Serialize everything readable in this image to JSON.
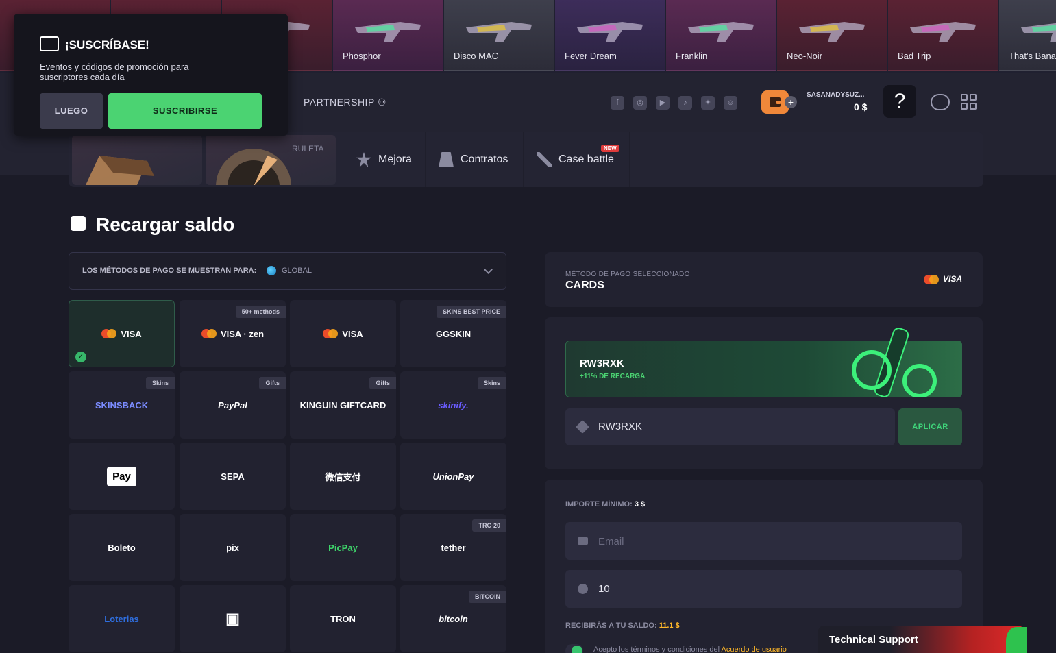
{
  "feed": [
    {
      "name": "",
      "rarity": "r-red"
    },
    {
      "name": "",
      "rarity": "r-red"
    },
    {
      "name": "",
      "rarity": "r-red"
    },
    {
      "name": "Phosphor",
      "rarity": "r-pink"
    },
    {
      "name": "Disco MAC",
      "rarity": "r-gray"
    },
    {
      "name": "Fever Dream",
      "rarity": "r-purple"
    },
    {
      "name": "Franklin",
      "rarity": "r-pink"
    },
    {
      "name": "Neo-Noir",
      "rarity": "r-red"
    },
    {
      "name": "Bad Trip",
      "rarity": "r-red"
    },
    {
      "name": "That's Bananas",
      "rarity": "r-gray"
    }
  ],
  "popup": {
    "title": "¡SUSCRÍBASE!",
    "text": "Eventos y códigos de promoción para suscriptores cada día",
    "later": "LUEGO",
    "subscribe": "SUSCRIBIRSE"
  },
  "header": {
    "partnership": "PARTNERSHIP",
    "username": "SASANADYSUZ...",
    "balance": "0 $",
    "help": "?",
    "socials": [
      "facebook-icon",
      "instagram-icon",
      "youtube-icon",
      "tiktok-icon",
      "twitter-icon",
      "discord-icon"
    ]
  },
  "nav": {
    "ruleta": "RULETA",
    "upgrade": "Mejora",
    "contracts": "Contratos",
    "battle": "Case battle",
    "new_badge": "NEW"
  },
  "page": {
    "title": "Recargar saldo",
    "region_label": "LOS MÉTODOS DE PAGO SE MUESTRAN PARA:",
    "region_value": "GLOBAL"
  },
  "methods": [
    {
      "label": "VISA",
      "tag": "",
      "selected": true
    },
    {
      "label": "VISA · zen",
      "tag": "50+ methods"
    },
    {
      "label": "VISA",
      "tag": ""
    },
    {
      "label": "GGSKIN",
      "tag": "SKINS BEST PRICE"
    },
    {
      "label": "SKINSBACK",
      "tag": "Skins"
    },
    {
      "label": "PayPal",
      "tag": "Gifts"
    },
    {
      "label": "KINGUIN GIFTCARD",
      "tag": "Gifts"
    },
    {
      "label": "skinify.",
      "tag": "Skins"
    },
    {
      "label": "Pay",
      "tag": ""
    },
    {
      "label": "SEPA",
      "tag": ""
    },
    {
      "label": "微信支付",
      "tag": ""
    },
    {
      "label": "UnionPay",
      "tag": ""
    },
    {
      "label": "Boleto",
      "tag": ""
    },
    {
      "label": "pix",
      "tag": ""
    },
    {
      "label": "PicPay",
      "tag": ""
    },
    {
      "label": "tether",
      "tag": "TRC-20"
    },
    {
      "label": "Loterias",
      "tag": ""
    },
    {
      "label": "",
      "tag": ""
    },
    {
      "label": "TRON",
      "tag": ""
    },
    {
      "label": "bitcoin",
      "tag": "BITCOIN"
    }
  ],
  "selected_method": {
    "small": "MÉTODO DE PAGO SELECCIONADO",
    "name": "CARDS",
    "brand": "VISA"
  },
  "promo": {
    "banner_code": "RW3RXK",
    "banner_sub": "+11% DE RECARGA",
    "code_value": "RW3RXK",
    "apply": "APLICAR"
  },
  "amount": {
    "min_label": "IMPORTE MÍNIMO:",
    "min_value": "3 $",
    "email_placeholder": "Email",
    "amount_value": "10",
    "receive_label": "RECIBIRÁS A TU SALDO:",
    "receive_value": "11.1 $",
    "terms_text": "Acepto los términos y condiciones del",
    "terms_link": "Acuerdo de usuario"
  },
  "support": {
    "label": "Technical Support"
  },
  "colors": {
    "accent_green": "#4bd372",
    "wallet_orange": "#f0883a",
    "gold": "#ffb829",
    "support_red": "#e02a2a"
  }
}
